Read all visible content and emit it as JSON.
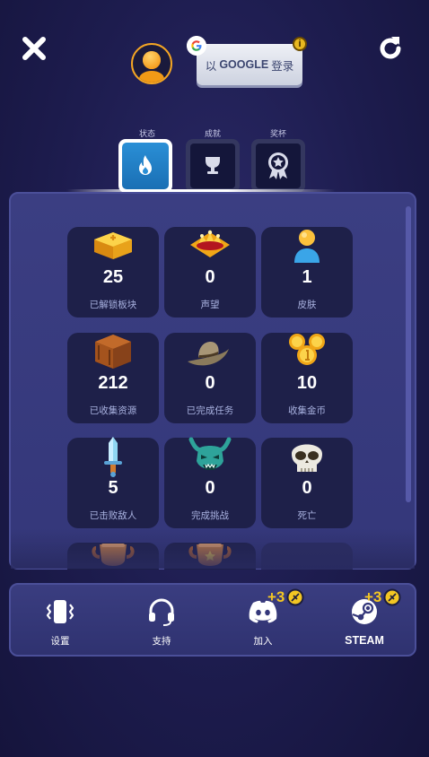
{
  "topbar": {
    "google_prefix": "以",
    "google_brand": "GOOGLE",
    "google_suffix": "登录",
    "info_badge": "i"
  },
  "tabs": [
    {
      "label": "状态",
      "icon": "flame-icon",
      "active": true
    },
    {
      "label": "成就",
      "icon": "trophy-cup-icon",
      "active": false
    },
    {
      "label": "奖杯",
      "icon": "award-ribbon-icon",
      "active": false
    }
  ],
  "stats": [
    {
      "value": "25",
      "label": "已解锁板块",
      "icon": "golden-tile-icon"
    },
    {
      "value": "0",
      "label": "声望",
      "icon": "crown-icon"
    },
    {
      "value": "1",
      "label": "皮肤",
      "icon": "person-skin-icon"
    },
    {
      "value": "212",
      "label": "已收集资源",
      "icon": "wooden-crate-icon"
    },
    {
      "value": "0",
      "label": "已完成任务",
      "icon": "cowboy-hat-icon"
    },
    {
      "value": "10",
      "label": "收集金币",
      "icon": "gold-coins-icon"
    },
    {
      "value": "5",
      "label": "已击败敌人",
      "icon": "sword-icon"
    },
    {
      "value": "0",
      "label": "完成挑战",
      "icon": "demon-mask-icon"
    },
    {
      "value": "0",
      "label": "死亡",
      "icon": "skull-icon"
    }
  ],
  "bottom_bar": [
    {
      "label": "设置",
      "icon": "vibration-phone-icon"
    },
    {
      "label": "支持",
      "icon": "headset-icon"
    },
    {
      "label": "加入",
      "icon": "discord-icon",
      "bonus": "+3"
    },
    {
      "label": "STEAM",
      "icon": "steam-icon",
      "bonus": "+3"
    }
  ],
  "colors": {
    "background": "#1d1c4e",
    "panel": "#3b3e82",
    "card": "#1e2049",
    "accent_blue": "#2a8fd6",
    "gold": "#f3c623"
  }
}
